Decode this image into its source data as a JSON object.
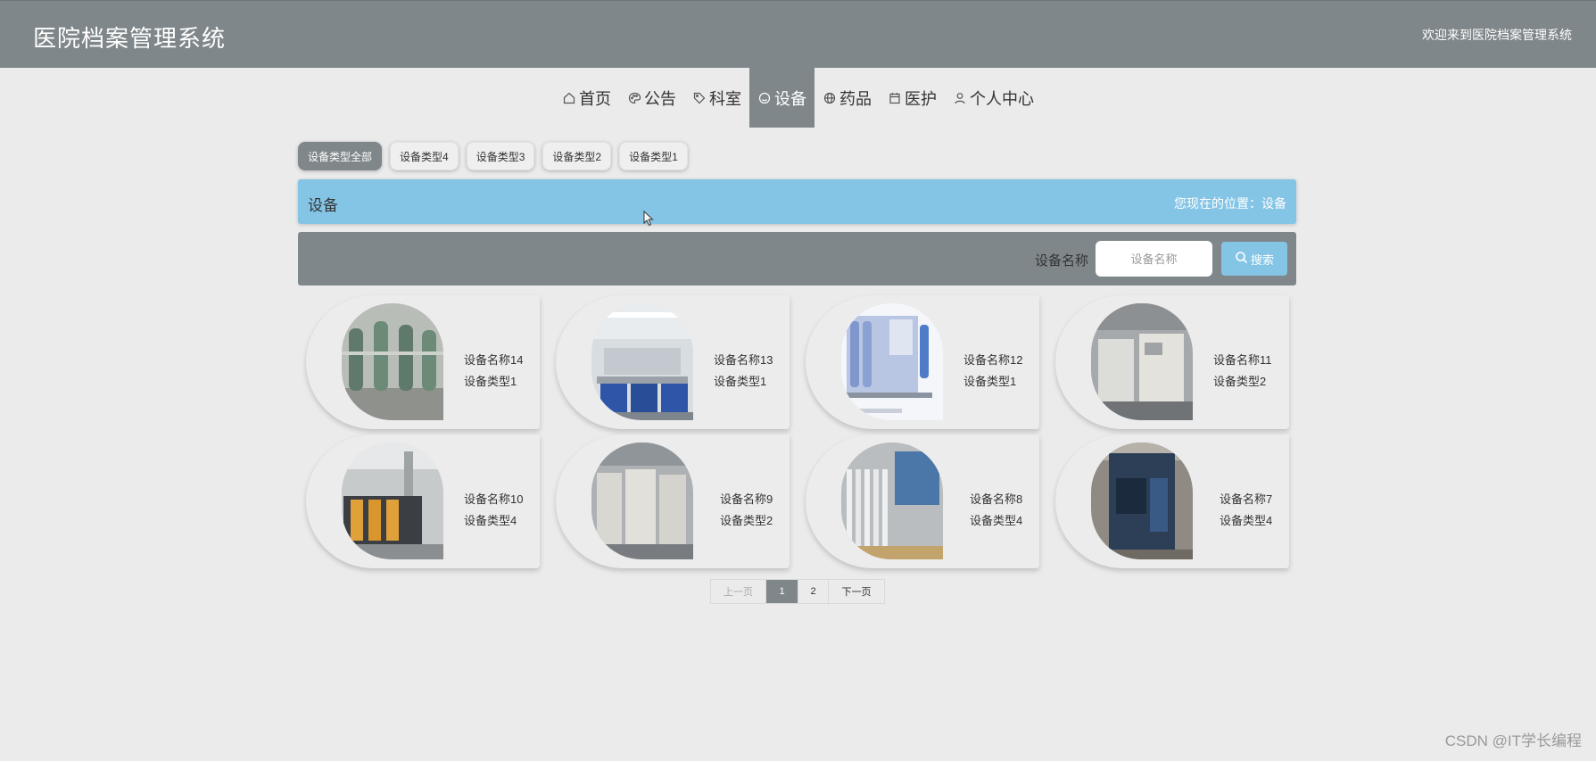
{
  "header": {
    "title": "医院档案管理系统",
    "welcome": "欢迎来到医院档案管理系统"
  },
  "nav": {
    "items": [
      {
        "label": "首页",
        "icon": "home-icon"
      },
      {
        "label": "公告",
        "icon": "palette-icon"
      },
      {
        "label": "科室",
        "icon": "tag-icon"
      },
      {
        "label": "设备",
        "icon": "smile-icon",
        "active": true
      },
      {
        "label": "药品",
        "icon": "globe-icon"
      },
      {
        "label": "医护",
        "icon": "calendar-icon"
      },
      {
        "label": "个人中心",
        "icon": "user-icon"
      }
    ]
  },
  "categories": [
    "设备类型全部",
    "设备类型4",
    "设备类型3",
    "设备类型2",
    "设备类型1"
  ],
  "crumb": {
    "section": "设备",
    "location": "您现在的位置：设备"
  },
  "search": {
    "label": "设备名称",
    "placeholder": "设备名称",
    "button": "搜索"
  },
  "devices": [
    {
      "name": "设备名称14",
      "type": "设备类型1"
    },
    {
      "name": "设备名称13",
      "type": "设备类型1"
    },
    {
      "name": "设备名称12",
      "type": "设备类型1"
    },
    {
      "name": "设备名称11",
      "type": "设备类型2"
    },
    {
      "name": "设备名称10",
      "type": "设备类型4"
    },
    {
      "name": "设备名称9",
      "type": "设备类型2"
    },
    {
      "name": "设备名称8",
      "type": "设备类型4"
    },
    {
      "name": "设备名称7",
      "type": "设备类型4"
    }
  ],
  "pager": {
    "prev": "上一页",
    "pages": [
      "1",
      "2"
    ],
    "current": "1",
    "next": "下一页"
  },
  "watermark": "CSDN @IT学长编程",
  "colors": {
    "header": "#7f878a",
    "accent": "#84c5e6",
    "background": "#ebebeb"
  }
}
